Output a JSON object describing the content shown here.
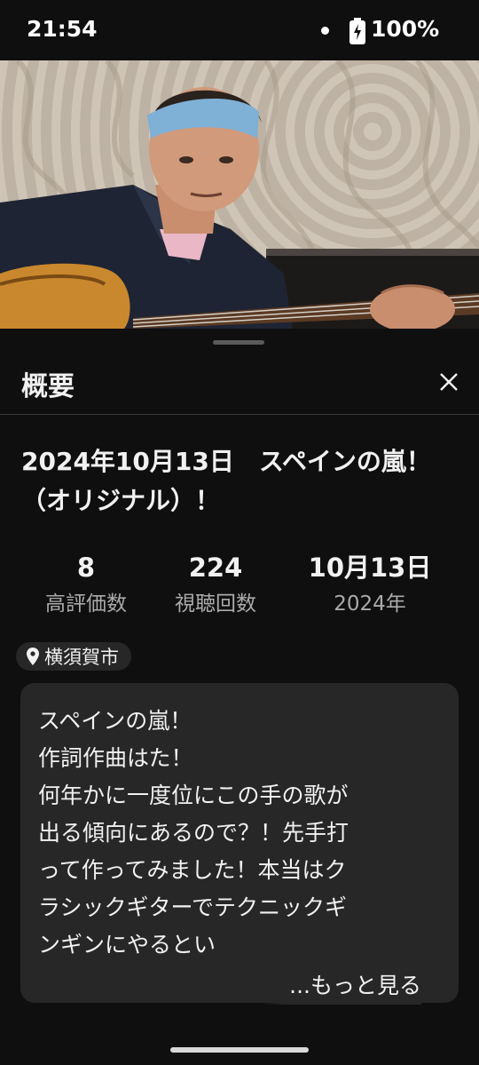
{
  "status_bar": {
    "time": "21:54",
    "battery": "100%"
  },
  "sheet": {
    "title": "概要",
    "video_title": "2024年10月13日　スペインの嵐！（オリジナル）！",
    "stats": [
      {
        "value": "8",
        "label": "高評価数"
      },
      {
        "value": "224",
        "label": "視聴回数"
      },
      {
        "value": "10月13日",
        "label": "2024年"
      }
    ],
    "location": "横須賀市",
    "description": "スペインの嵐！\n作詞作曲はた！\n何年かに一度位にこの手の歌が\n出る傾向にあるので？！先手打\nって作ってみました！本当はク\nラシックギターでテクニックギ\nンギンにやるとい",
    "more_label": "...もっと見る"
  },
  "icons": {
    "close": "close-icon",
    "pin": "location-pin-icon",
    "battery": "battery-charging-icon"
  },
  "colors": {
    "background": "#0f0f0f",
    "surface": "#272727",
    "secondary_text": "#aaaaaa"
  }
}
